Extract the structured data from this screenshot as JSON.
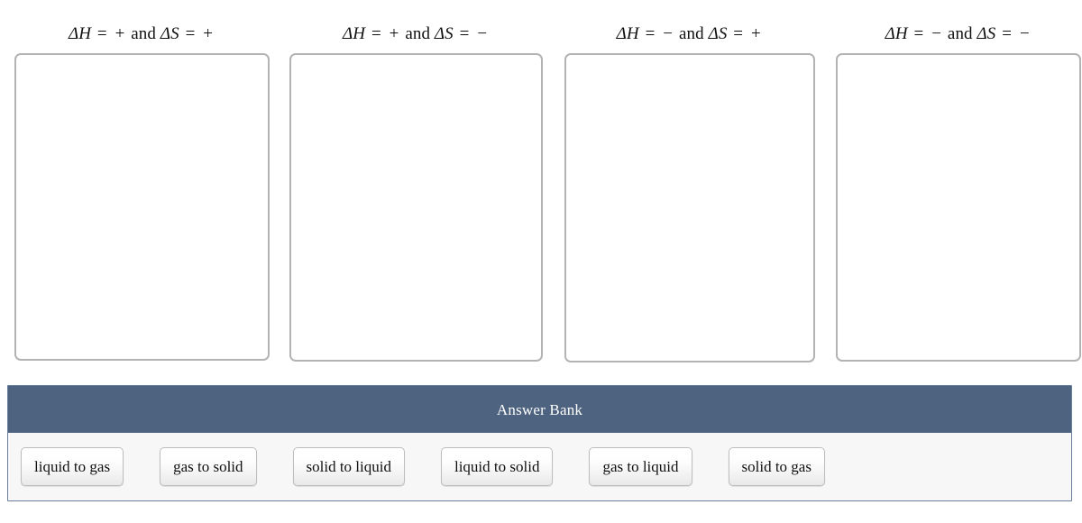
{
  "colors": {
    "header_bar": "#4e6380",
    "panel_border": "#6c7f9c",
    "zone_border": "#b3b3b3",
    "tile_border": "#bdbdbd",
    "panel_body": "#f7f7f7",
    "page_background": "#ffffff",
    "text": "#111111",
    "header_text": "#ffffff"
  },
  "dropzones": [
    {
      "id": "zone-1",
      "title": "ΔH = + and ΔS = +",
      "delta_h": "+",
      "delta_s": "+",
      "items": []
    },
    {
      "id": "zone-2",
      "title": "ΔH = + and ΔS = −",
      "delta_h": "+",
      "delta_s": "−",
      "items": []
    },
    {
      "id": "zone-3",
      "title": "ΔH = − and ΔS = +",
      "delta_h": "−",
      "delta_s": "+",
      "items": []
    },
    {
      "id": "zone-4",
      "title": "ΔH = − and ΔS = −",
      "delta_h": "−",
      "delta_s": "−",
      "items": []
    }
  ],
  "title_parts": {
    "delta": "Δ",
    "h": "H",
    "s": "S",
    "equals": "=",
    "and": "and"
  },
  "answer_bank": {
    "title": "Answer Bank",
    "tiles": [
      {
        "id": "tile-liquid-to-gas",
        "label": "liquid to gas"
      },
      {
        "id": "tile-gas-to-solid",
        "label": "gas to solid"
      },
      {
        "id": "tile-solid-to-liquid",
        "label": "solid to liquid"
      },
      {
        "id": "tile-liquid-to-solid",
        "label": "liquid to solid"
      },
      {
        "id": "tile-gas-to-liquid",
        "label": "gas to liquid"
      },
      {
        "id": "tile-solid-to-gas",
        "label": "solid to gas"
      }
    ]
  }
}
